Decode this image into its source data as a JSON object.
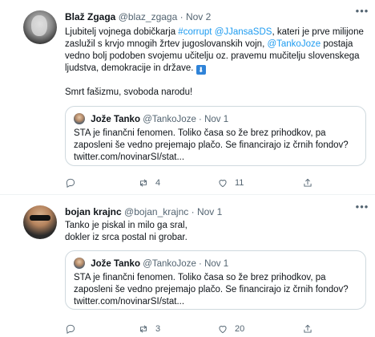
{
  "tweets": [
    {
      "author_name": "Blaž Zgaga",
      "handle": "@blaz_zgaga",
      "dot": "·",
      "date": "Nov 2",
      "more_icon": "more-horizontal-icon",
      "body_parts": {
        "p1": "Ljubitelj vojnega dobičkarja ",
        "link1": "#corrupt",
        "p2": " ",
        "link2": "@JJansaSDS",
        "p3": ", kateri je prve milijone zaslužil s krvjo mnogih žrtev jugoslovanskih vojn, ",
        "link3": "@TankoJoze",
        "p4": " postaja vedno bolj podoben svojemu učitelju oz. pravemu mučitelju slovenskega ljudstva, demokracije in države.",
        "emoji": "⬇",
        "p5": "Smrt fašizmu, svoboda narodu!"
      },
      "quote": {
        "author_name": "Jože Tanko",
        "handle": "@TankoJoze",
        "dot": "·",
        "date": "Nov 1",
        "text": "STA je finančni fenomen. Toliko časa so že brez prihodkov, pa zaposleni še vedno prejemajo plačo. Se financirajo iz črnih fondov?",
        "link": "twitter.com/novinarSI/stat..."
      },
      "actions": {
        "reply_count": "",
        "retweet_count": "4",
        "like_count": "11"
      }
    },
    {
      "author_name": "bojan krajnc",
      "handle": "@bojan_krajnc",
      "dot": "·",
      "date": "Nov 1",
      "more_icon": "more-horizontal-icon",
      "body_lines": [
        "Tanko je piskal in milo ga sral,",
        "dokler iz srca postal ni grobar."
      ],
      "quote": {
        "author_name": "Jože Tanko",
        "handle": "@TankoJoze",
        "dot": "·",
        "date": "Nov 1",
        "text": "STA je finančni fenomen. Toliko časa so že brez prihodkov, pa zaposleni še vedno prejemajo plačo. Se financirajo iz črnih fondov?",
        "link": "twitter.com/novinarSI/stat..."
      },
      "actions": {
        "reply_count": "",
        "retweet_count": "3",
        "like_count": "20"
      }
    }
  ],
  "colors": {
    "link": "#1d9bf0",
    "secondary_text": "#536471",
    "border": "#cfd9de"
  }
}
